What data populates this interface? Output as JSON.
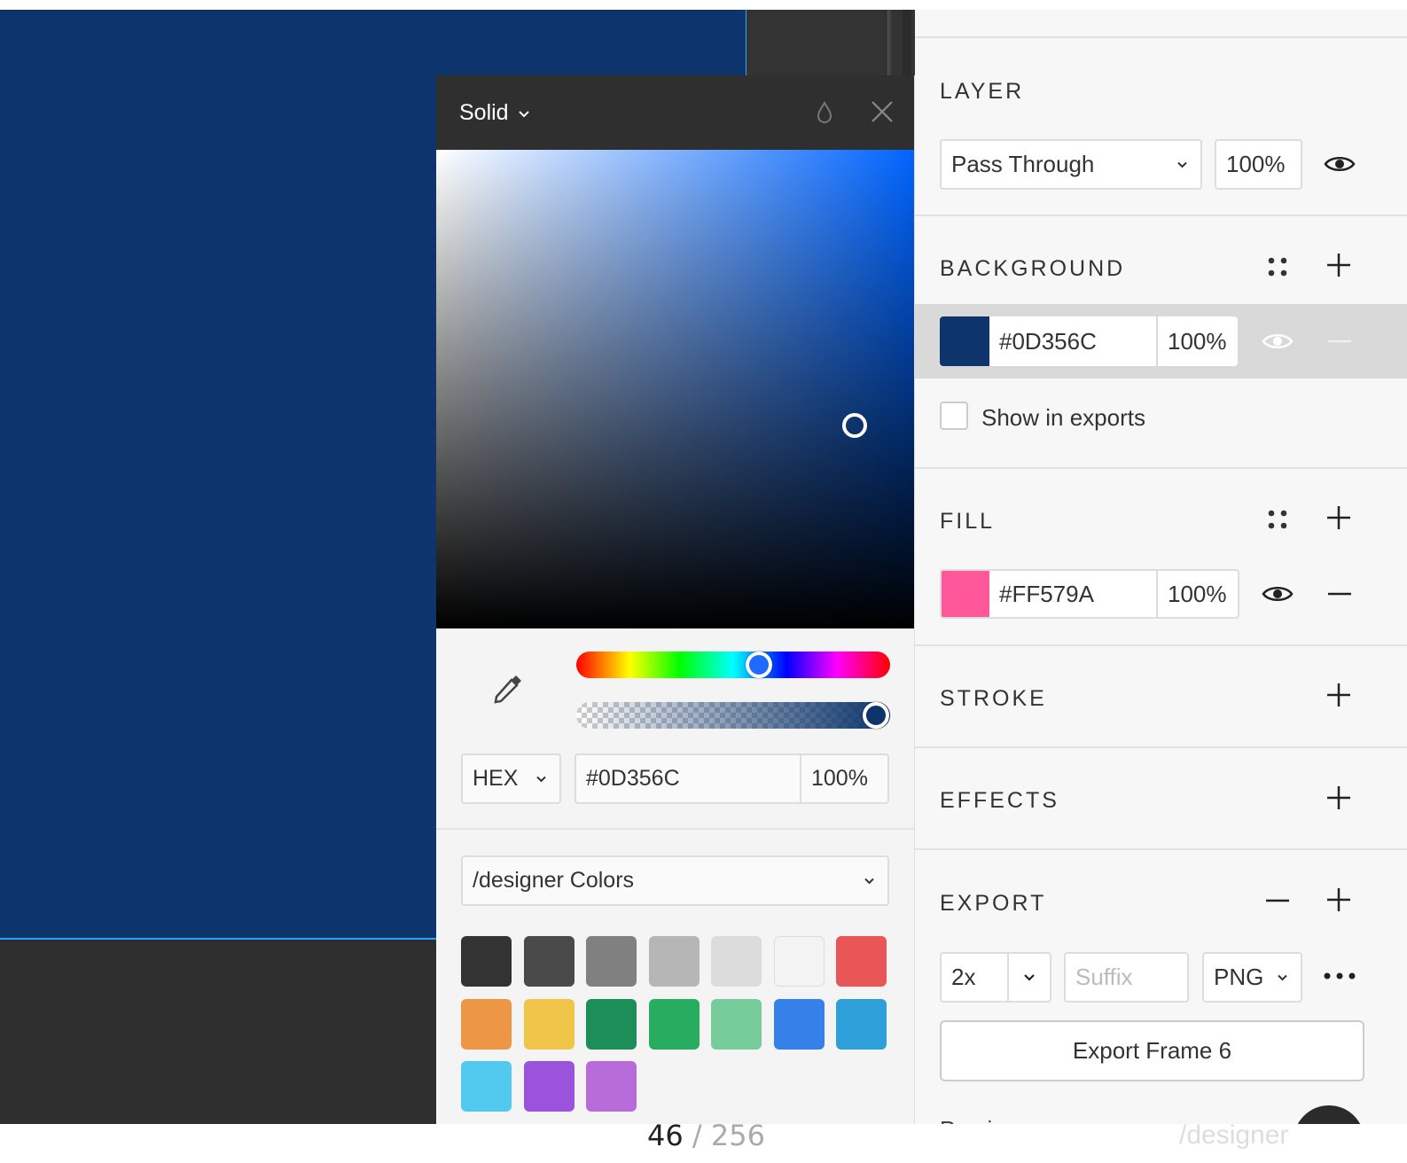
{
  "picker": {
    "mode": "Solid",
    "format": "HEX",
    "hex": "#0D356C",
    "opacity": "100%",
    "library": "/designer Colors",
    "swatches": [
      "#333333",
      "#4a4a4a",
      "#808080",
      "#b6b6b6",
      "#dcdcdc",
      "#f3f3f3",
      "#e85657",
      "#ed9746",
      "#f0c54a",
      "#1c8f59",
      "#28ad60",
      "#76cd9b",
      "#3680ea",
      "#2d9fd9",
      "#52c9ee",
      "#9b53dd",
      "#b86cd9"
    ]
  },
  "layer": {
    "title": "LAYER",
    "blend": "Pass Through",
    "opacity": "100%"
  },
  "background": {
    "title": "BACKGROUND",
    "hex": "#0D356C",
    "opacity": "100%",
    "swatch": "#0D356C",
    "show_in_exports": "Show in exports"
  },
  "fill": {
    "title": "FILL",
    "hex": "#FF579A",
    "opacity": "100%",
    "swatch": "#FF579A"
  },
  "stroke": {
    "title": "STROKE"
  },
  "effects": {
    "title": "EFFECTS"
  },
  "export": {
    "title": "EXPORT",
    "scale": "2x",
    "suffix_placeholder": "Suffix",
    "format": "PNG",
    "button": "Export Frame 6",
    "preview": "Preview"
  },
  "footer": {
    "page": "46",
    "sep_total": " / 256",
    "brand": "/designer"
  }
}
